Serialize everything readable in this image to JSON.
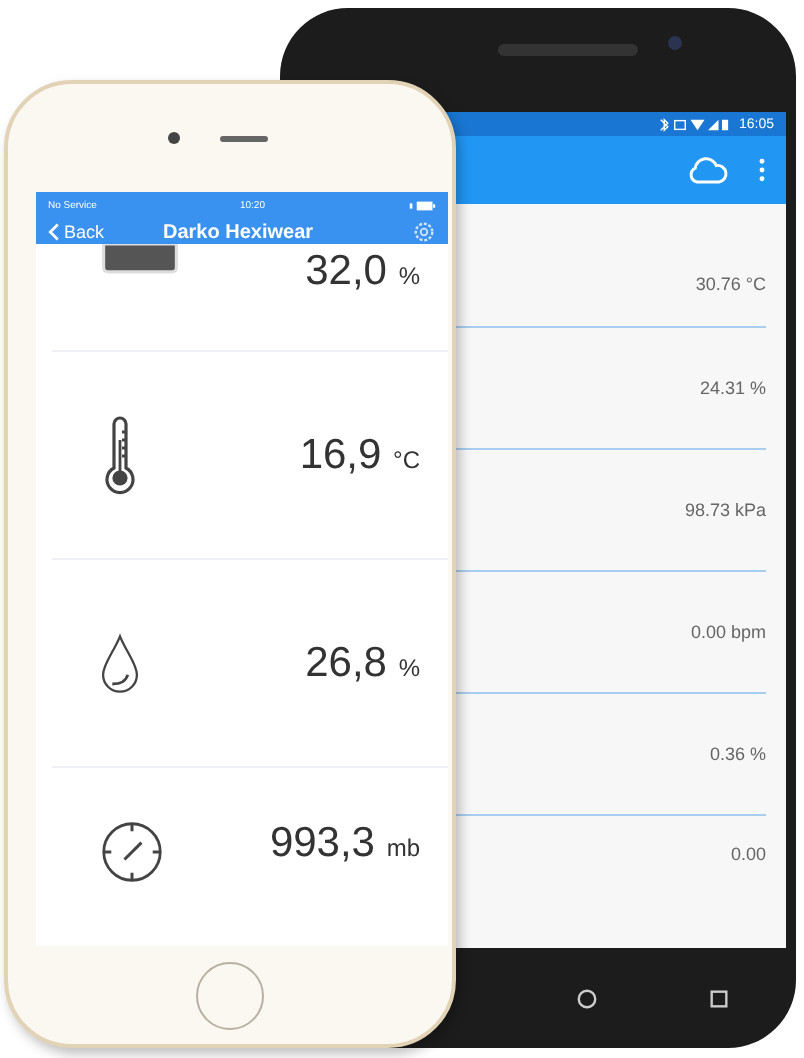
{
  "android_phone": {
    "status_time": "16:05",
    "readings": [
      {
        "value": "30.76 °C"
      },
      {
        "value": "24.31 %"
      },
      {
        "value": "98.73 kPa"
      },
      {
        "value": "0.00 bpm"
      },
      {
        "value": "0.36 %"
      },
      {
        "value": "0.00"
      }
    ]
  },
  "iphone": {
    "carrier": "No Service",
    "time": "10:20",
    "back": "Back",
    "title": "Darko Hexiwear",
    "sensors": [
      {
        "kind": "battery",
        "value": "32,0",
        "unit": "%"
      },
      {
        "kind": "thermometer",
        "value": "16,9",
        "unit": "°C"
      },
      {
        "kind": "humidity",
        "value": "26,8",
        "unit": "%"
      },
      {
        "kind": "pressure",
        "value": "993,3",
        "unit": "mb"
      }
    ]
  }
}
